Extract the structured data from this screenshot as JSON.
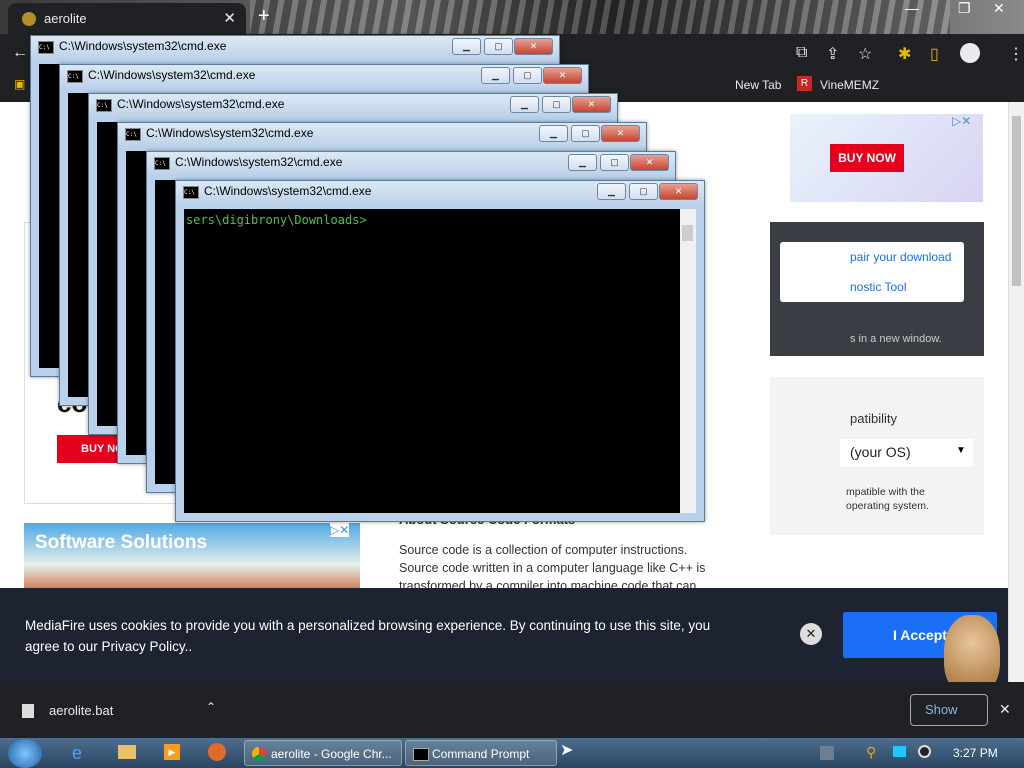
{
  "browser": {
    "tab_title": "aerolite",
    "new_tab_symbol": "+",
    "bookmarks": [
      {
        "label": "New Tab"
      },
      {
        "label": "VineMEMZ"
      }
    ]
  },
  "ads": {
    "top_right_button": "BUY NOW",
    "left_button": "BUY NO",
    "software_solutions": "Software Solutions"
  },
  "page": {
    "repair_link_1": "pair your download",
    "repair_link_2": "nostic Tool",
    "new_window_note": "s in a new window.",
    "compat_heading": "patibility",
    "os_select_value": "(your OS)",
    "compat_note_1": "mpatible with the",
    "compat_note_2": "operating system.",
    "left_fragment": "co",
    "about_heading": "About Source Code Formats",
    "about_text": "Source code is a collection of computer instructions. Source code written in a computer language like C++ is transformed by a compiler into machine code that can"
  },
  "cookie": {
    "text": "MediaFire uses cookies to provide you with a personalized browsing experience. By continuing to use this site, you agree to our Privacy Policy..",
    "accept_label": "I Accept"
  },
  "download_bar": {
    "file_name": "aerolite.bat",
    "show_all": "Show"
  },
  "cmd_windows": [
    {
      "title": "C:\\Windows\\system32\\cmd.exe"
    },
    {
      "title": "C:\\Windows\\system32\\cmd.exe"
    },
    {
      "title": "C:\\Windows\\system32\\cmd.exe"
    },
    {
      "title": "C:\\Windows\\system32\\cmd.exe"
    },
    {
      "title": "C:\\Windows\\system32\\cmd.exe"
    },
    {
      "title": "C:\\Windows\\system32\\cmd.exe",
      "prompt": "sers\\digibrony\\Downloads>"
    }
  ],
  "taskbar": {
    "chrome_button": "aerolite - Google Chr...",
    "cmd_button": "Command Prompt",
    "clock": "3:27 PM"
  }
}
